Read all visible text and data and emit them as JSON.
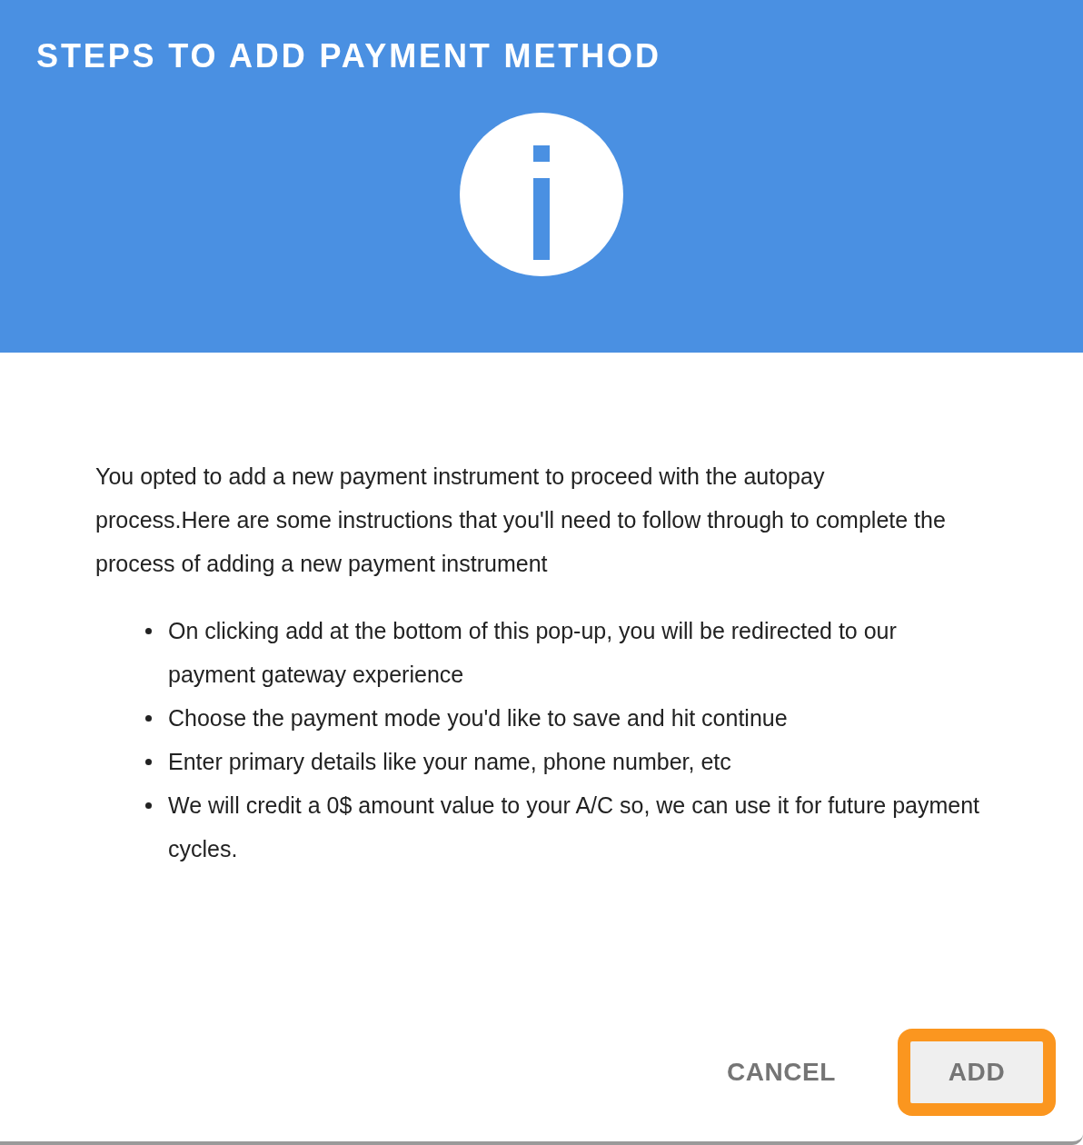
{
  "dialog": {
    "title": "STEPS TO ADD PAYMENT METHOD",
    "intro": "You opted to add a new payment instrument to proceed with the autopay process.Here are some instructions that you'll need to follow through to complete the process of adding a new payment instrument",
    "steps": [
      "On clicking add at the bottom of this pop-up, you will be redirected to our payment gateway experience",
      "Choose the payment mode you'd like to save and hit continue",
      "Enter primary details like your name, phone number, etc",
      "We will credit a 0$ amount value to your A/C so, we can use it for future payment cycles."
    ],
    "buttons": [
      {
        "label": "CANCEL",
        "kind": "text",
        "focused": false
      },
      {
        "label": "ADD",
        "kind": "filled",
        "focused": true
      }
    ]
  }
}
